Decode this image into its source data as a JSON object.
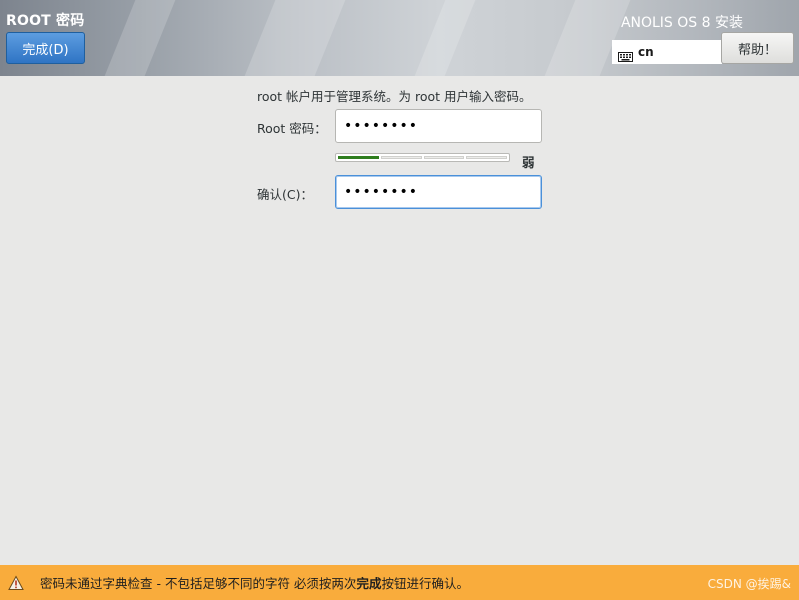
{
  "header": {
    "page_title": "ROOT 密码",
    "done_button": "完成(D)",
    "product_title": "ANOLIS OS 8 安装",
    "keyboard_layout": "cn",
    "help_button": "帮助！"
  },
  "form": {
    "intro_text": "root 帐户用于管理系统。为 root 用户输入密码。",
    "root_password_label": "Root 密码：",
    "root_password_value": "12345678",
    "strength_text": "弱",
    "strength_level": 0.25,
    "confirm_label": "确认(C)：",
    "confirm_value": "12345678"
  },
  "warning": {
    "text_before": "密码未通过字典检查 - 不包括足够不同的字符 必须按两次",
    "text_bold": "完成",
    "text_after": "按钮进行确认。",
    "watermark": "CSDN @挨踢&"
  },
  "colors": {
    "accent_button": "#3b7fd0",
    "warning_bar": "#f9ac3c",
    "strength_weak": "#2e7d1e"
  }
}
